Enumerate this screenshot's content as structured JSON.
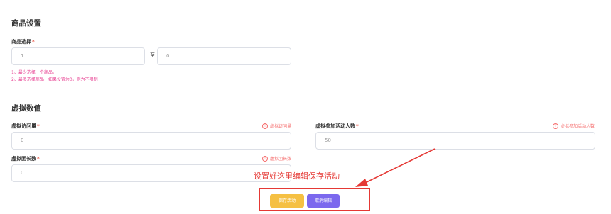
{
  "product_section": {
    "title": "商品设置",
    "select_label": "商品选择",
    "required_mark": "*",
    "min_value": "1",
    "to_label": "至",
    "max_value": "0",
    "hints": [
      "1、最少选择一个商品。",
      "2、最多选择商品，如果设置为0，则为不限制"
    ]
  },
  "virtual_section": {
    "title": "虚拟数值",
    "visits_label": "虚拟访问量",
    "visits_tip": "虚拟访问量",
    "visits_value": "0",
    "participants_label": "虚拟参加活动人数",
    "participants_tip": "虚拟参加活动人数",
    "participants_value": "50",
    "groups_label": "虚拟团长数",
    "groups_tip": "虚拟团长数",
    "groups_value": "0"
  },
  "annotation": {
    "text": "设置好这里编辑保存活动",
    "color": "#e53935"
  },
  "actions": {
    "save_label": "保存活动",
    "cancel_label": "取消编辑",
    "save_color": "#f5c043",
    "cancel_color": "#7b68ee"
  }
}
